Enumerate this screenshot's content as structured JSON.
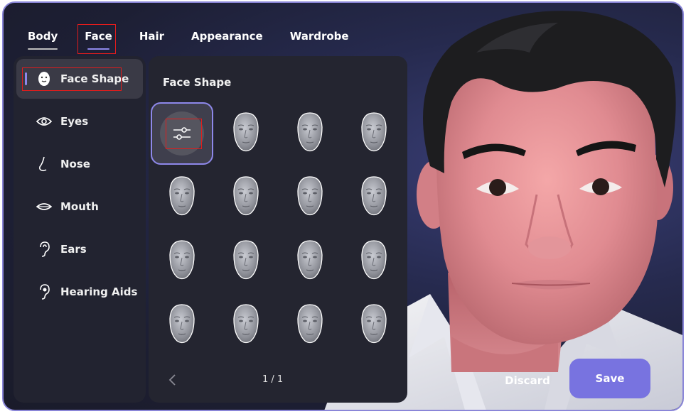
{
  "nav": {
    "tabs": [
      {
        "label": "Body"
      },
      {
        "label": "Face"
      },
      {
        "label": "Hair"
      },
      {
        "label": "Appearance"
      },
      {
        "label": "Wardrobe"
      }
    ],
    "active": "Face"
  },
  "categories": [
    {
      "label": "Face Shape",
      "icon": "face-icon"
    },
    {
      "label": "Eyes",
      "icon": "eye-icon"
    },
    {
      "label": "Nose",
      "icon": "nose-icon"
    },
    {
      "label": "Mouth",
      "icon": "mouth-icon"
    },
    {
      "label": "Ears",
      "icon": "ear-icon"
    },
    {
      "label": "Hearing Aids",
      "icon": "hearing-aid-icon"
    }
  ],
  "panel": {
    "title": "Face Shape",
    "custom_icon": "sliders-icon",
    "face_option_count": 15,
    "page_text": "1 / 1"
  },
  "actions": {
    "discard": "Discard",
    "save": "Save"
  },
  "colors": {
    "accent": "#8e88ea",
    "save_button": "#7873e0",
    "highlight_box": "#e21c1c"
  }
}
